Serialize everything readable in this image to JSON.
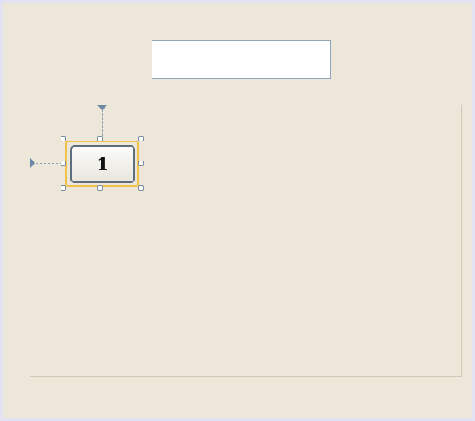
{
  "designer": {
    "textbox": {
      "value": ""
    },
    "selected_button": {
      "label": "1"
    },
    "handles": [
      "top-left",
      "top-center",
      "top-right",
      "middle-left",
      "middle-right",
      "bottom-left",
      "bottom-center",
      "bottom-right"
    ]
  },
  "colors": {
    "background": "#ece7d9",
    "frame_border": "#e2e2f2",
    "selection": "#f0c24a",
    "guide": "#6c8aa6"
  }
}
